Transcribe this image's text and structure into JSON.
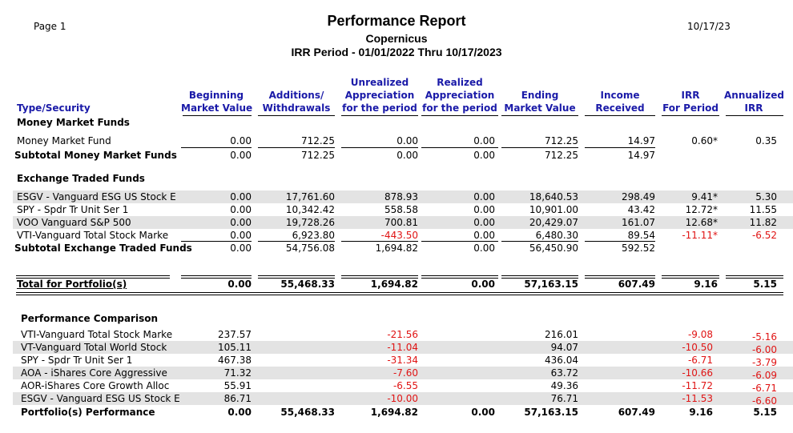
{
  "report": {
    "page": "Page  1",
    "title": "Performance Report",
    "account": "Copernicus",
    "period": "IRR Period - 01/01/2022 Thru 10/17/2023",
    "date": "10/17/23"
  },
  "columns": {
    "type": "Type/Security",
    "begin": [
      "Beginning",
      "Market Value"
    ],
    "additions": [
      "Additions/",
      "Withdrawals"
    ],
    "unrealized": [
      "Unrealized",
      "Appreciation",
      "for the period"
    ],
    "realized": [
      "Realized",
      "Appreciation",
      "for the period"
    ],
    "ending": [
      "Ending",
      "Market Value"
    ],
    "income": [
      "Income",
      "Received"
    ],
    "irr": [
      "IRR",
      "For Period"
    ],
    "annualized": [
      "Annualized",
      "IRR"
    ]
  },
  "money_market": {
    "section_label": "Money Market Funds",
    "rows": [
      {
        "name": "Money Market Fund",
        "begin": "0.00",
        "additions": "712.25",
        "unrealized": "0.00",
        "realized": "0.00",
        "ending": "712.25",
        "income": "14.97",
        "irr": "0.60*",
        "annualized": "0.35"
      }
    ],
    "subtotal": {
      "name": "Subtotal Money Market Funds",
      "begin": "0.00",
      "additions": "712.25",
      "unrealized": "0.00",
      "realized": "0.00",
      "ending": "712.25",
      "income": "14.97"
    }
  },
  "etf": {
    "section_label": "Exchange Traded Funds",
    "rows": [
      {
        "name": "ESGV - Vanguard ESG US Stock E",
        "begin": "0.00",
        "additions": "17,761.60",
        "unrealized": "878.93",
        "realized": "0.00",
        "ending": "18,640.53",
        "income": "298.49",
        "irr": "9.41*",
        "annualized": "5.30"
      },
      {
        "name": "SPY - Spdr Tr Unit Ser 1",
        "begin": "0.00",
        "additions": "10,342.42",
        "unrealized": "558.58",
        "realized": "0.00",
        "ending": "10,901.00",
        "income": "43.42",
        "irr": "12.72*",
        "annualized": "11.55"
      },
      {
        "name": "VOO Vanguard S&P 500",
        "begin": "0.00",
        "additions": "19,728.26",
        "unrealized": "700.81",
        "realized": "0.00",
        "ending": "20,429.07",
        "income": "161.07",
        "irr": "12.68*",
        "annualized": "11.82"
      },
      {
        "name": "VTI-Vanguard Total Stock Marke",
        "begin": "0.00",
        "additions": "6,923.80",
        "unrealized": "-443.50",
        "realized": "0.00",
        "ending": "6,480.30",
        "income": "89.54",
        "irr": "-11.11*",
        "annualized": "-6.52"
      }
    ],
    "subtotal": {
      "name": "Subtotal Exchange Traded Funds",
      "begin": "0.00",
      "additions": "54,756.08",
      "unrealized": "1,694.82",
      "realized": "0.00",
      "ending": "56,450.90",
      "income": "592.52"
    }
  },
  "total": {
    "name": "Total for Portfolio(s)",
    "begin": "0.00",
    "additions": "55,468.33",
    "unrealized": "1,694.82",
    "realized": "0.00",
    "ending": "57,163.15",
    "income": "607.49",
    "irr": "9.16",
    "annualized": "5.15"
  },
  "comparison": {
    "section_label": "Performance Comparison",
    "rows": [
      {
        "name": "VTI-Vanguard Total Stock Marke",
        "begin": "237.57",
        "unrealized": "-21.56",
        "ending": "216.01",
        "irr": "-9.08",
        "annualized": "-5.16"
      },
      {
        "name": "VT-Vanguard Total World Stock",
        "begin": "105.11",
        "unrealized": "-11.04",
        "ending": "94.07",
        "irr": "-10.50",
        "annualized": "-6.00"
      },
      {
        "name": "SPY - Spdr Tr Unit Ser 1",
        "begin": "467.38",
        "unrealized": "-31.34",
        "ending": "436.04",
        "irr": "-6.71",
        "annualized": "-3.79"
      },
      {
        "name": "AOA - iShares Core Aggressive",
        "begin": "71.32",
        "unrealized": "-7.60",
        "ending": "63.72",
        "irr": "-10.66",
        "annualized": "-6.09"
      },
      {
        "name": "AOR-iShares Core Growth Alloc",
        "begin": "55.91",
        "unrealized": "-6.55",
        "ending": "49.36",
        "irr": "-11.72",
        "annualized": "-6.71"
      },
      {
        "name": "ESGV - Vanguard ESG US Stock E",
        "begin": "86.71",
        "unrealized": "-10.00",
        "ending": "76.71",
        "irr": "-11.53",
        "annualized": "-6.60"
      }
    ],
    "portfolio": {
      "name": "Portfolio(s) Performance",
      "begin": "0.00",
      "additions": "55,468.33",
      "unrealized": "1,694.82",
      "realized": "0.00",
      "ending": "57,163.15",
      "income": "607.49",
      "irr": "9.16",
      "annualized": "5.15"
    }
  },
  "colors": {
    "header_text": "#1a1aa8",
    "negative": "#e01414",
    "shade": "#e3e3e3"
  }
}
